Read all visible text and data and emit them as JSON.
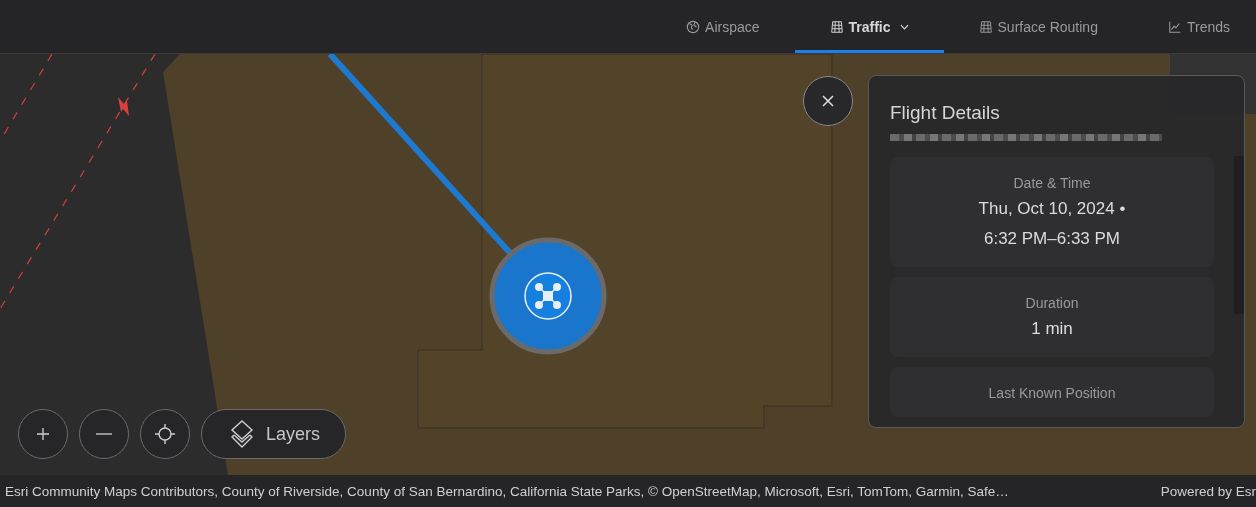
{
  "tabs": [
    {
      "label": "Airspace",
      "kind": "globe",
      "selected": false,
      "has_menu": false
    },
    {
      "label": "Traffic",
      "kind": "grid",
      "selected": true,
      "has_menu": true
    },
    {
      "label": "Surface Routing",
      "kind": "grid",
      "selected": false,
      "has_menu": false
    },
    {
      "label": "Trends",
      "kind": "chart",
      "selected": false,
      "has_menu": false
    }
  ],
  "map_controls": [
    {
      "kind": "zoom-in"
    },
    {
      "kind": "zoom-out"
    },
    {
      "kind": "locate"
    }
  ],
  "layers_button": {
    "label": "Layers"
  },
  "flight_panel": {
    "title": "Flight Details",
    "id_redacted": true,
    "cards": [
      {
        "label": "Date & Time",
        "lines": [
          "Thu, Oct 10, 2024 •",
          "6:32 PM–6:33 PM"
        ]
      },
      {
        "label": "Duration",
        "lines": [
          "1 min"
        ]
      },
      {
        "label": "Last Known Position"
      }
    ]
  },
  "attribution": {
    "text": "Esri Community Maps Contributors, County of Riverside, County of San Bernardino, California State Parks, © OpenStreetMap, Microsoft, Esri, TomTom, Garmin, Safe…",
    "powered_by": "Powered by Esr"
  }
}
